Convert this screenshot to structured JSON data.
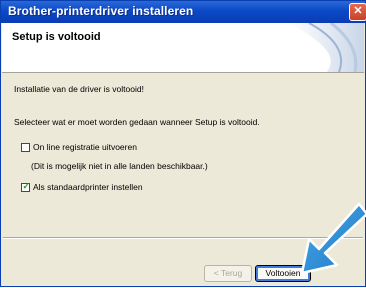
{
  "window": {
    "title": "Brother-printerdriver installeren"
  },
  "header": {
    "title": "Setup is voltooid"
  },
  "content": {
    "installed_text": "Installatie van de driver is voltooid!",
    "select_text": "Selecteer wat er moet worden gedaan wanneer Setup is voltooid.",
    "options": [
      {
        "label": "On line registratie uitvoeren",
        "checked": false
      },
      {
        "label": "Als standaardprinter instellen",
        "checked": true
      }
    ],
    "note": "(Dit is mogelijk niet in alle landen beschikbaar.)"
  },
  "buttons": {
    "back": "< Terug",
    "finish": "Voltooien"
  },
  "colors": {
    "titlebar": "#0b49c6",
    "arrow": "#2a8fd6",
    "dialog_bg": "#ece9d8"
  },
  "icons": [
    "close-icon",
    "checkmark-icon",
    "pointer-arrow-icon"
  ]
}
